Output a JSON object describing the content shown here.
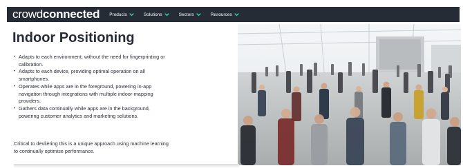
{
  "header": {
    "logo_prefix": "crowd",
    "logo_suffix": "connected",
    "nav": [
      {
        "label": "Products"
      },
      {
        "label": "Solutions"
      },
      {
        "label": "Sectors"
      },
      {
        "label": "Resources"
      }
    ],
    "accent_color": "#2fd1a9",
    "bar_color": "#262c36"
  },
  "main": {
    "title": "Indoor Positioning",
    "bullets": [
      "Adapts to each environment, without the need for fingerprinting or calibration.",
      "Adapts to each device, providing optimal operation on all smartphones.",
      "Operates while apps are in the foreground, powering in-app navigation through integrations with multiple indoor-mapping providers.",
      "Gathers data continually while apps are in the background, powering customer analytics and marketing solutions."
    ],
    "closing": "Critical to devliering this is a unique approach using machine learning to continually optimise performance."
  },
  "hero_image": {
    "subject": "crowd-of-people-walking-in-exhibition-hall-icon"
  }
}
